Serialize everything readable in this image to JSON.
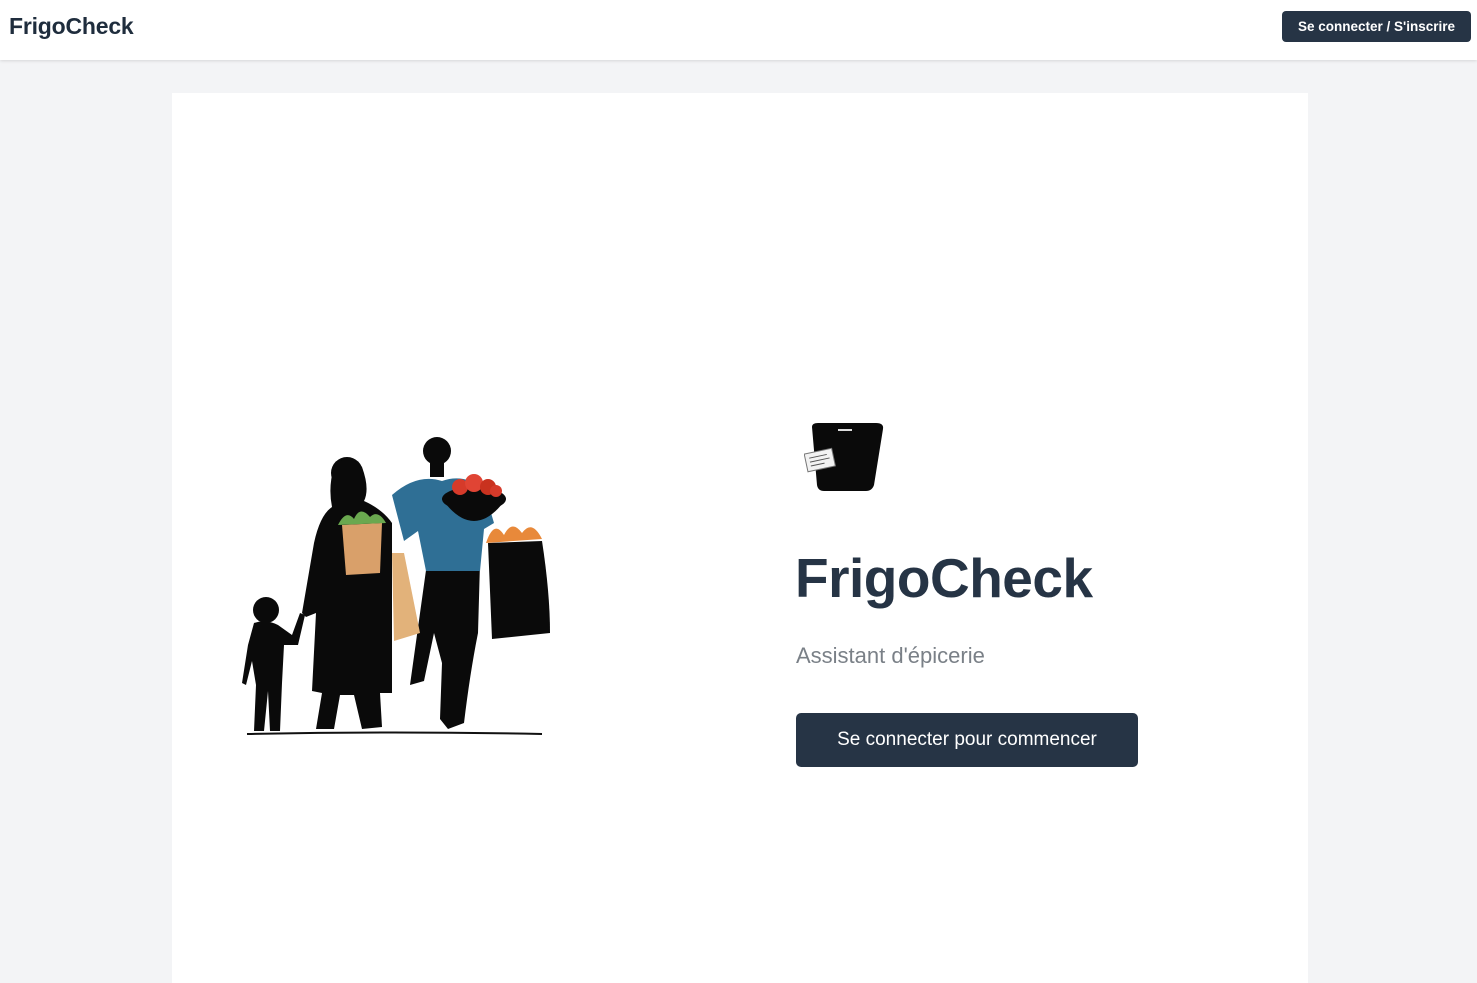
{
  "header": {
    "brand": "FrigoCheck",
    "auth_button_label": "Se connecter / S'inscrire"
  },
  "hero": {
    "title": "FrigoCheck",
    "subtitle": "Assistant d'épicerie",
    "cta_label": "Se connecter pour commencer",
    "illustration_icon": "family-shopping-illustration",
    "logo_icon": "fridge-check-logo-icon"
  },
  "colors": {
    "primary": "#263445",
    "page_background": "#f3f4f6",
    "card_background": "#ffffff",
    "subtitle_text": "#7a8087"
  }
}
